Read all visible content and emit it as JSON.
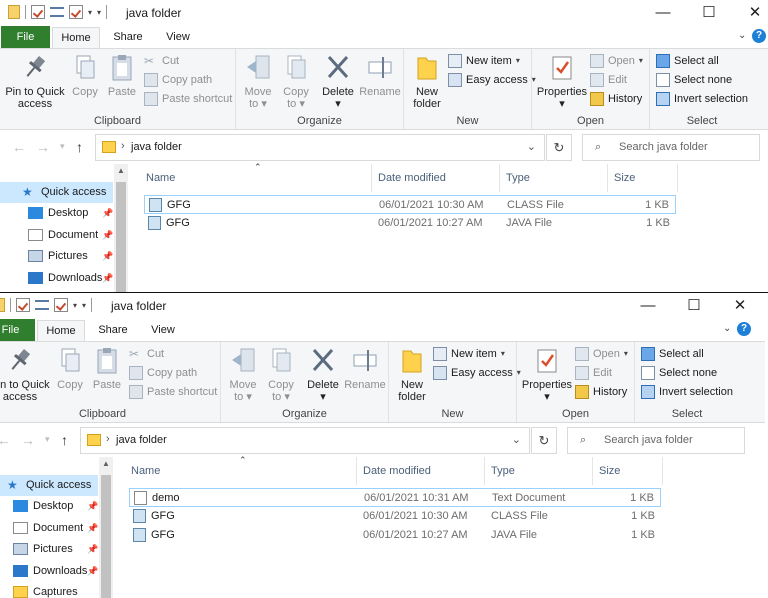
{
  "colors": {
    "file_tab": "#2f7f2f",
    "help": "#1e7fd7",
    "selection": "#cce8ff"
  },
  "icons": {
    "folder": "folder-icon",
    "properties": "properties-checkmark-icon",
    "rename": "rename-icon",
    "dropdown": "dropdown-arrow-icon"
  },
  "windows": [
    {
      "title": "java folder",
      "controls": {
        "minimize": "—",
        "maximize": "☐",
        "close": "✕"
      },
      "tabs": {
        "file": "File",
        "home": "Home",
        "share": "Share",
        "view": "View"
      },
      "ribbon": {
        "pin_line1": "Pin to Quick",
        "pin_line2": "access",
        "copy": "Copy",
        "paste": "Paste",
        "cut": "Cut",
        "copy_path": "Copy path",
        "paste_shortcut": "Paste shortcut",
        "clipboard": "Clipboard",
        "move_to": "Move",
        "move_to2": "to",
        "copy_to": "Copy",
        "copy_to2": "to",
        "delete": "Delete",
        "rename": "Rename",
        "organize": "Organize",
        "new_folder1": "New",
        "new_folder2": "folder",
        "new_item": "New item",
        "easy_access": "Easy access",
        "new": "New",
        "properties": "Properties",
        "open": "Open",
        "edit": "Edit",
        "history": "History",
        "open_group": "Open",
        "select_all": "Select all",
        "select_none": "Select none",
        "invert_selection": "Invert selection",
        "select": "Select"
      },
      "address": {
        "path": "java folder",
        "search_placeholder": "Search java folder"
      },
      "nav": {
        "quick_access": "Quick access",
        "items": [
          "Desktop",
          "Document",
          "Pictures",
          "Downloads"
        ]
      },
      "columns": {
        "name": "Name",
        "date": "Date modified",
        "type": "Type",
        "size": "Size"
      },
      "files": [
        {
          "name": "GFG",
          "date": "06/01/2021 10:30 AM",
          "type": "CLASS File",
          "size": "1 KB"
        },
        {
          "name": "GFG",
          "date": "06/01/2021 10:27 AM",
          "type": "JAVA File",
          "size": "1 KB"
        }
      ]
    },
    {
      "title": "java folder",
      "controls": {
        "minimize": "—",
        "maximize": "☐",
        "close": "✕"
      },
      "tabs": {
        "file": "File",
        "home": "Home",
        "share": "Share",
        "view": "View"
      },
      "ribbon": {
        "pin_line1": "Pin to Quick",
        "pin_line2": "access",
        "copy": "Copy",
        "paste": "Paste",
        "cut": "Cut",
        "copy_path": "Copy path",
        "paste_shortcut": "Paste shortcut",
        "clipboard": "Clipboard",
        "move_to": "Move",
        "move_to2": "to",
        "copy_to": "Copy",
        "copy_to2": "to",
        "delete": "Delete",
        "rename": "Rename",
        "organize": "Organize",
        "new_folder1": "New",
        "new_folder2": "folder",
        "new_item": "New item",
        "easy_access": "Easy access",
        "new": "New",
        "properties": "Properties",
        "open": "Open",
        "edit": "Edit",
        "history": "History",
        "open_group": "Open",
        "select_all": "Select all",
        "select_none": "Select none",
        "invert_selection": "Invert selection",
        "select": "Select"
      },
      "address": {
        "path": "java folder",
        "search_placeholder": "Search java folder"
      },
      "nav": {
        "quick_access": "Quick access",
        "items": [
          "Desktop",
          "Document",
          "Pictures",
          "Downloads",
          "Captures"
        ]
      },
      "columns": {
        "name": "Name",
        "date": "Date modified",
        "type": "Type",
        "size": "Size"
      },
      "files": [
        {
          "name": "demo",
          "date": "06/01/2021 10:31 AM",
          "type": "Text Document",
          "size": "1 KB"
        },
        {
          "name": "GFG",
          "date": "06/01/2021 10:30 AM",
          "type": "CLASS File",
          "size": "1 KB"
        },
        {
          "name": "GFG",
          "date": "06/01/2021 10:27 AM",
          "type": "JAVA File",
          "size": "1 KB"
        }
      ]
    }
  ]
}
